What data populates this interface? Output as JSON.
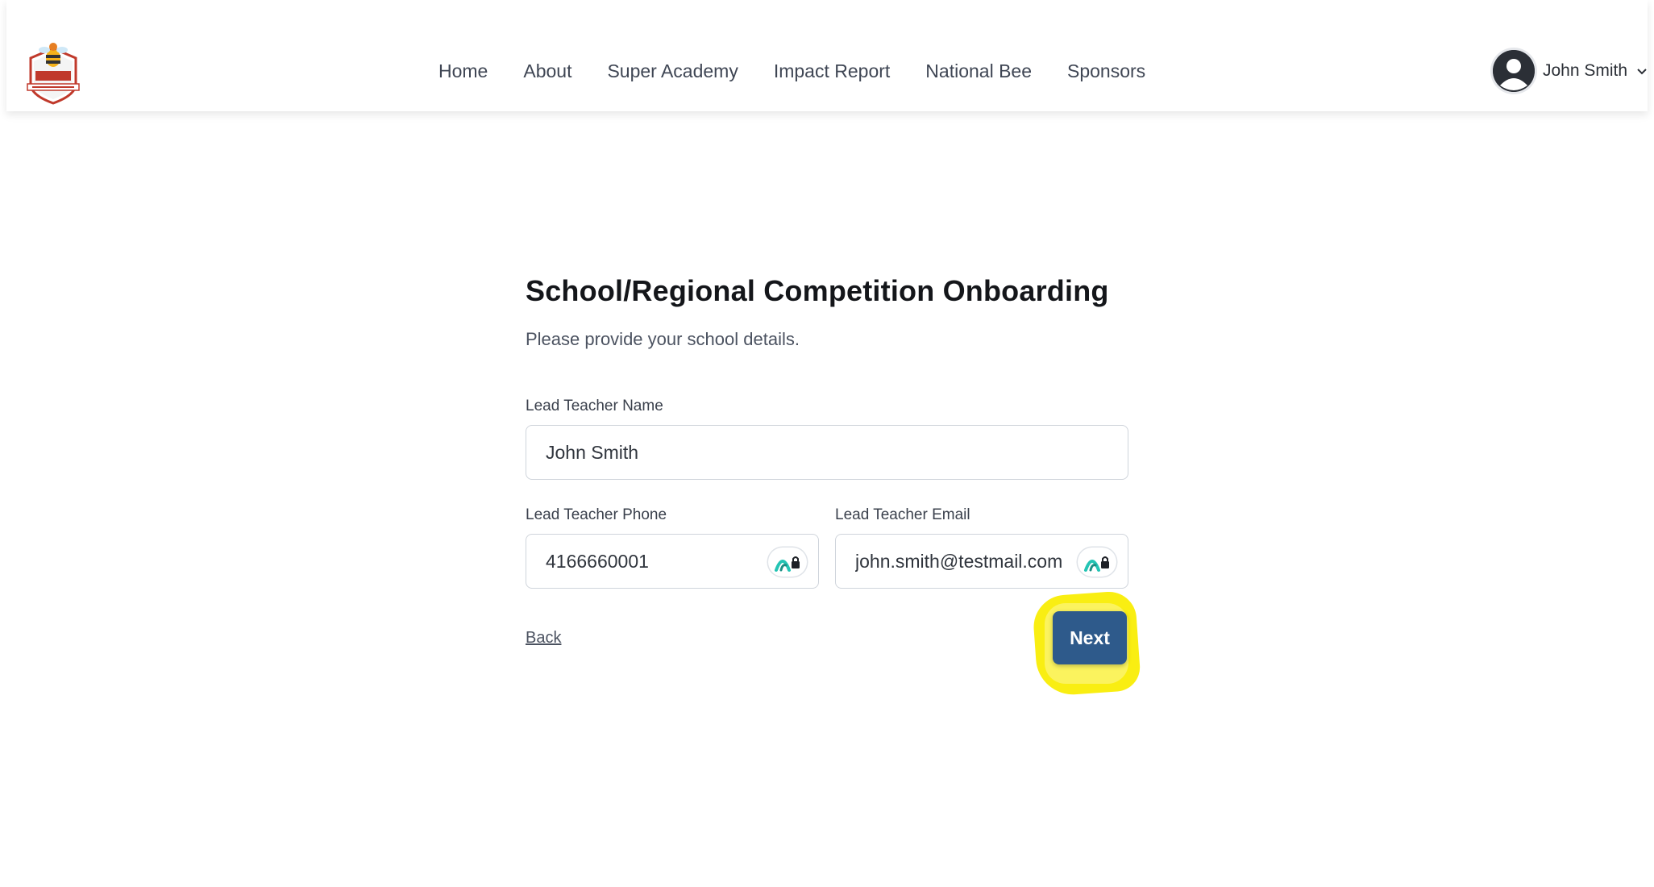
{
  "nav": {
    "items": [
      {
        "label": "Home"
      },
      {
        "label": "About"
      },
      {
        "label": "Super Academy"
      },
      {
        "label": "Impact Report"
      },
      {
        "label": "National Bee"
      },
      {
        "label": "Sponsors"
      }
    ]
  },
  "user": {
    "name": "John Smith"
  },
  "form": {
    "title": "School/Regional Competition Onboarding",
    "subtitle": "Please provide your school details.",
    "lead_teacher_name": {
      "label": "Lead Teacher Name",
      "value": "John Smith"
    },
    "lead_teacher_phone": {
      "label": "Lead Teacher Phone",
      "value": "4166660001"
    },
    "lead_teacher_email": {
      "label": "Lead Teacher Email",
      "value": "john.smith@testmail.com"
    },
    "back_label": "Back",
    "next_label": "Next"
  },
  "colors": {
    "primary_button": "#2e5a8b",
    "highlight": "#f9ee12",
    "badge_accent": "#24c4b4"
  },
  "icons": {
    "logo": "bee-shield-logo",
    "avatar": "user-circle-icon",
    "chevron": "chevron-down-icon",
    "field_badge": "password-manager-lock-icon"
  }
}
